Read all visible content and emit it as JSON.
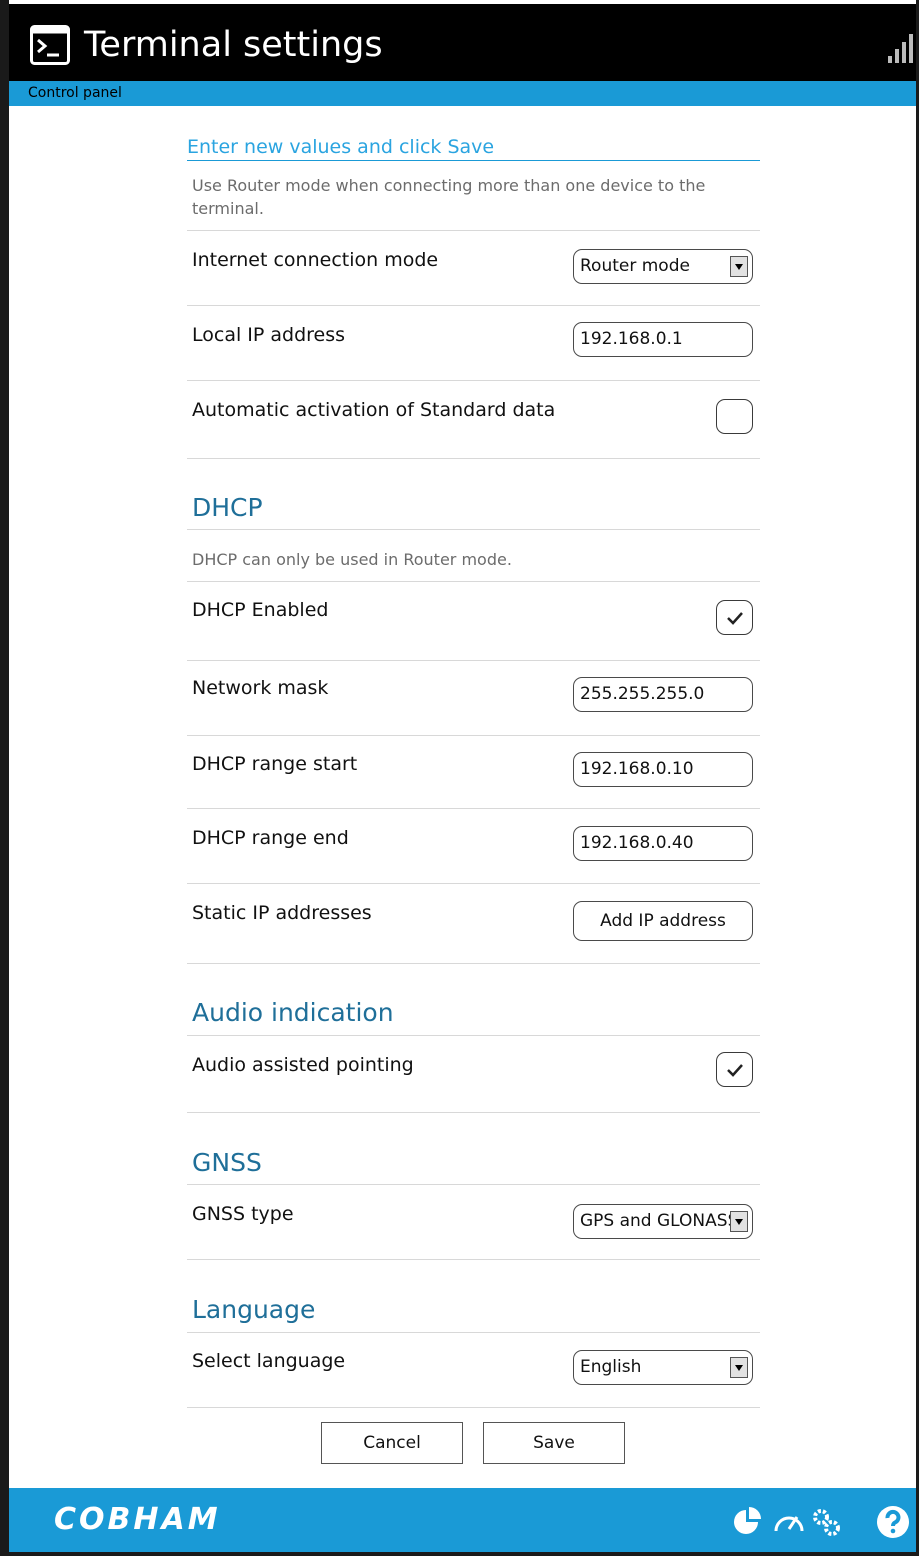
{
  "header": {
    "title": "Terminal settings",
    "subbar": "Control panel",
    "icons": [
      "terminal-icon",
      "signal-strength-icon"
    ]
  },
  "form": {
    "intro_heading": "Enter new values and click Save",
    "router_help": "Use Router mode when connecting more than one device to the terminal.",
    "internet_mode": {
      "label": "Internet connection mode",
      "value": "Router mode"
    },
    "local_ip": {
      "label": "Local IP address",
      "value": "192.168.0.1"
    },
    "auto_activation": {
      "label": "Automatic activation of Standard data",
      "checked": false
    },
    "dhcp": {
      "heading": "DHCP",
      "help": "DHCP can only be used in Router mode.",
      "enabled": {
        "label": "DHCP Enabled",
        "checked": true
      },
      "network_mask": {
        "label": "Network mask",
        "value": "255.255.255.0"
      },
      "range_start": {
        "label": "DHCP range start",
        "value": "192.168.0.10"
      },
      "range_end": {
        "label": "DHCP range end",
        "value": "192.168.0.40"
      },
      "static_ip": {
        "label": "Static IP addresses",
        "button": "Add IP address"
      }
    },
    "audio": {
      "heading": "Audio indication",
      "pointing": {
        "label": "Audio assisted pointing",
        "checked": true
      }
    },
    "gnss": {
      "heading": "GNSS",
      "type": {
        "label": "GNSS type",
        "value": "GPS and GLONASS"
      }
    },
    "language": {
      "heading": "Language",
      "select": {
        "label": "Select language",
        "value": "English"
      }
    },
    "cancel": "Cancel",
    "save": "Save"
  },
  "footer": {
    "brand": "COBHAM",
    "icons": [
      "dashboard-pie-icon",
      "gauge-icon",
      "settings-gears-icon",
      "help-icon"
    ]
  },
  "colors": {
    "accent": "#1a9ad6",
    "section": "#1f6f99",
    "header_bg": "#000000"
  }
}
